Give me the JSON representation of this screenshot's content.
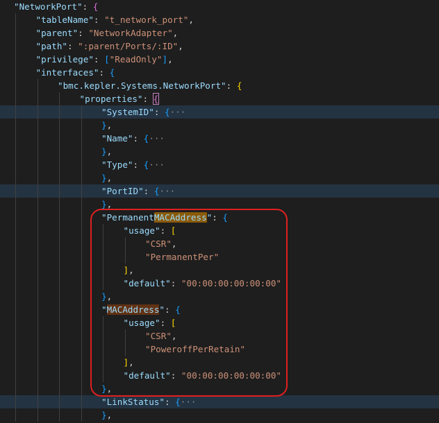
{
  "editor": {
    "language": "json",
    "lines": [
      {
        "indent": 0,
        "folded": false,
        "tokens": [
          {
            "t": "\"NetworkPort\"",
            "c": "k"
          },
          {
            "t": ": ",
            "c": "p"
          },
          {
            "t": "{",
            "c": "b2"
          }
        ]
      },
      {
        "indent": 1,
        "folded": false,
        "tokens": [
          {
            "t": "\"tableName\"",
            "c": "k"
          },
          {
            "t": ": ",
            "c": "p"
          },
          {
            "t": "\"t_network_port\"",
            "c": "s"
          },
          {
            "t": ",",
            "c": "p"
          }
        ]
      },
      {
        "indent": 1,
        "folded": false,
        "tokens": [
          {
            "t": "\"parent\"",
            "c": "k"
          },
          {
            "t": ": ",
            "c": "p"
          },
          {
            "t": "\"NetworkAdapter\"",
            "c": "s"
          },
          {
            "t": ",",
            "c": "p"
          }
        ]
      },
      {
        "indent": 1,
        "folded": false,
        "tokens": [
          {
            "t": "\"path\"",
            "c": "k"
          },
          {
            "t": ": ",
            "c": "p"
          },
          {
            "t": "\":parent/Ports/:ID\"",
            "c": "s"
          },
          {
            "t": ",",
            "c": "p"
          }
        ]
      },
      {
        "indent": 1,
        "folded": false,
        "tokens": [
          {
            "t": "\"privilege\"",
            "c": "k"
          },
          {
            "t": ": ",
            "c": "p"
          },
          {
            "t": "[",
            "c": "b3"
          },
          {
            "t": "\"ReadOnly\"",
            "c": "s"
          },
          {
            "t": "]",
            "c": "b3"
          },
          {
            "t": ",",
            "c": "p"
          }
        ]
      },
      {
        "indent": 1,
        "folded": false,
        "tokens": [
          {
            "t": "\"interfaces\"",
            "c": "k"
          },
          {
            "t": ": ",
            "c": "p"
          },
          {
            "t": "{",
            "c": "b3"
          }
        ]
      },
      {
        "indent": 2,
        "folded": false,
        "tokens": [
          {
            "t": "\"bmc.kepler.Systems.NetworkPort\"",
            "c": "k"
          },
          {
            "t": ": ",
            "c": "p"
          },
          {
            "t": "{",
            "c": "b1"
          }
        ]
      },
      {
        "indent": 3,
        "folded": false,
        "tokens": [
          {
            "t": "\"properties\"",
            "c": "k"
          },
          {
            "t": ": ",
            "c": "p"
          },
          {
            "t": "{",
            "c": "b2",
            "box": true
          }
        ]
      },
      {
        "indent": 4,
        "folded": true,
        "tokens": [
          {
            "t": "\"SystemID\"",
            "c": "k"
          },
          {
            "t": ": ",
            "c": "p"
          },
          {
            "t": "{",
            "c": "b3"
          },
          {
            "t": "···",
            "c": "fold"
          }
        ]
      },
      {
        "indent": 4,
        "folded": false,
        "tokens": [
          {
            "t": "}",
            "c": "b3"
          },
          {
            "t": ",",
            "c": "p"
          }
        ]
      },
      {
        "indent": 4,
        "folded": false,
        "tokens": [
          {
            "t": "\"Name\"",
            "c": "k"
          },
          {
            "t": ": ",
            "c": "p"
          },
          {
            "t": "{",
            "c": "b3"
          },
          {
            "t": "···",
            "c": "fold"
          }
        ]
      },
      {
        "indent": 4,
        "folded": false,
        "tokens": [
          {
            "t": "}",
            "c": "b3"
          },
          {
            "t": ",",
            "c": "p"
          }
        ]
      },
      {
        "indent": 4,
        "folded": false,
        "tokens": [
          {
            "t": "\"Type\"",
            "c": "k"
          },
          {
            "t": ": ",
            "c": "p"
          },
          {
            "t": "{",
            "c": "b3"
          },
          {
            "t": "···",
            "c": "fold"
          }
        ]
      },
      {
        "indent": 4,
        "folded": false,
        "tokens": [
          {
            "t": "}",
            "c": "b3"
          },
          {
            "t": ",",
            "c": "p"
          }
        ]
      },
      {
        "indent": 4,
        "folded": true,
        "tokens": [
          {
            "t": "\"PortID\"",
            "c": "k"
          },
          {
            "t": ": ",
            "c": "p"
          },
          {
            "t": "{",
            "c": "b3"
          },
          {
            "t": "···",
            "c": "fold"
          }
        ]
      },
      {
        "indent": 4,
        "folded": false,
        "tokens": [
          {
            "t": "}",
            "c": "b3"
          },
          {
            "t": ",",
            "c": "p"
          }
        ]
      },
      {
        "indent": 4,
        "folded": false,
        "tokens": [
          {
            "t": "\"Permanent",
            "c": "k"
          },
          {
            "t": "MACAddress",
            "c": "hl"
          },
          {
            "t": "\"",
            "c": "k"
          },
          {
            "t": ": ",
            "c": "p"
          },
          {
            "t": "{",
            "c": "b3"
          }
        ]
      },
      {
        "indent": 5,
        "folded": false,
        "tokens": [
          {
            "t": "\"usage\"",
            "c": "k"
          },
          {
            "t": ": ",
            "c": "p"
          },
          {
            "t": "[",
            "c": "b1"
          }
        ]
      },
      {
        "indent": 6,
        "folded": false,
        "tokens": [
          {
            "t": "\"CSR\"",
            "c": "s"
          },
          {
            "t": ",",
            "c": "p"
          }
        ]
      },
      {
        "indent": 6,
        "folded": false,
        "tokens": [
          {
            "t": "\"PermanentPer\"",
            "c": "s"
          }
        ]
      },
      {
        "indent": 5,
        "folded": false,
        "tokens": [
          {
            "t": "]",
            "c": "b1"
          },
          {
            "t": ",",
            "c": "p"
          }
        ]
      },
      {
        "indent": 5,
        "folded": false,
        "tokens": [
          {
            "t": "\"default\"",
            "c": "k"
          },
          {
            "t": ": ",
            "c": "p"
          },
          {
            "t": "\"00:00:00:00:00:00\"",
            "c": "s"
          }
        ]
      },
      {
        "indent": 4,
        "folded": false,
        "tokens": [
          {
            "t": "}",
            "c": "b3"
          },
          {
            "t": ",",
            "c": "p"
          }
        ]
      },
      {
        "indent": 4,
        "folded": false,
        "tokens": [
          {
            "t": "\"",
            "c": "k"
          },
          {
            "t": "MACAddress",
            "c": "hl2"
          },
          {
            "t": "\"",
            "c": "k"
          },
          {
            "t": ": ",
            "c": "p"
          },
          {
            "t": "{",
            "c": "b3"
          }
        ]
      },
      {
        "indent": 5,
        "folded": false,
        "tokens": [
          {
            "t": "\"usage\"",
            "c": "k"
          },
          {
            "t": ": ",
            "c": "p"
          },
          {
            "t": "[",
            "c": "b1"
          }
        ]
      },
      {
        "indent": 6,
        "folded": false,
        "tokens": [
          {
            "t": "\"CSR\"",
            "c": "s"
          },
          {
            "t": ",",
            "c": "p"
          }
        ]
      },
      {
        "indent": 6,
        "folded": false,
        "tokens": [
          {
            "t": "\"PoweroffPerRetain\"",
            "c": "s"
          }
        ]
      },
      {
        "indent": 5,
        "folded": false,
        "tokens": [
          {
            "t": "]",
            "c": "b1"
          },
          {
            "t": ",",
            "c": "p"
          }
        ]
      },
      {
        "indent": 5,
        "folded": false,
        "tokens": [
          {
            "t": "\"default\"",
            "c": "k"
          },
          {
            "t": ": ",
            "c": "p"
          },
          {
            "t": "\"00:00:00:00:00:00\"",
            "c": "s"
          }
        ]
      },
      {
        "indent": 4,
        "folded": false,
        "tokens": [
          {
            "t": "}",
            "c": "b3"
          },
          {
            "t": ",",
            "c": "p"
          }
        ]
      },
      {
        "indent": 4,
        "folded": true,
        "tokens": [
          {
            "t": "\"LinkStatus\"",
            "c": "k"
          },
          {
            "t": ": ",
            "c": "p"
          },
          {
            "t": "{",
            "c": "b3"
          },
          {
            "t": "···",
            "c": "fold"
          }
        ]
      },
      {
        "indent": 4,
        "folded": false,
        "tokens": [
          {
            "t": "}",
            "c": "b3"
          },
          {
            "t": ",",
            "c": "p"
          }
        ]
      }
    ]
  },
  "colors": {
    "background": "#1e1e1e",
    "key": "#9cdcfe",
    "string": "#ce9178",
    "annotation": "#e02020"
  }
}
